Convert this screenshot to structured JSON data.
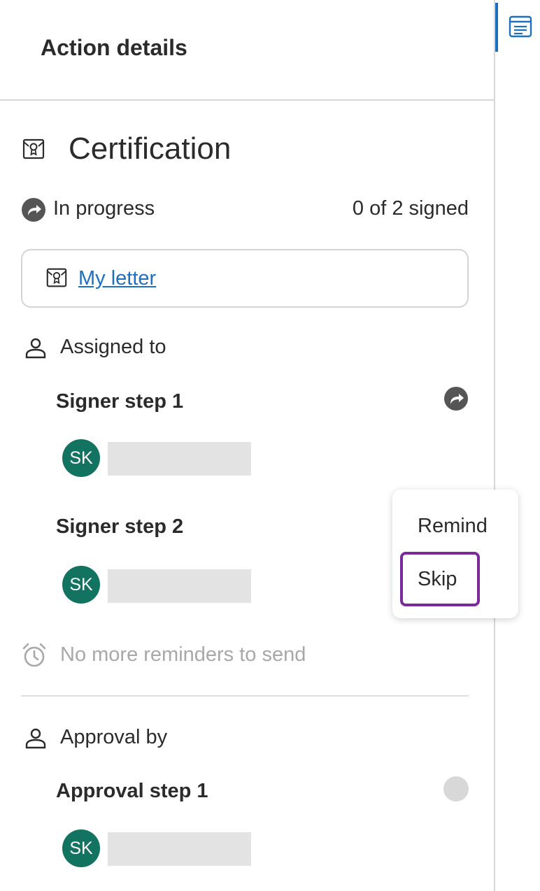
{
  "header": {
    "title": "Action details"
  },
  "certification": {
    "title": "Certification",
    "icon": "certificate-icon",
    "status": "In progress",
    "status_icon": "forward-arrow-icon",
    "signed_count": "0 of 2 signed",
    "document_link": "My letter"
  },
  "assigned": {
    "label": "Assigned to",
    "icon": "person-icon",
    "steps": [
      {
        "title": "Signer step 1",
        "initials": "SK",
        "status_icon": "forward-arrow-icon"
      },
      {
        "title": "Signer step 2",
        "initials": "SK"
      }
    ],
    "reminder_text": "No more reminders to send"
  },
  "approval": {
    "label": "Approval by",
    "icon": "person-icon",
    "steps": [
      {
        "title": "Approval step 1",
        "initials": "SK",
        "status": "pending"
      }
    ]
  },
  "context_menu": {
    "items": [
      "Remind",
      "Skip"
    ],
    "focused": "Skip"
  },
  "colors": {
    "accent": "#1f6fbf",
    "avatar": "#137361",
    "focus": "#7a2a9b",
    "muted_text": "#a8a8a8"
  }
}
